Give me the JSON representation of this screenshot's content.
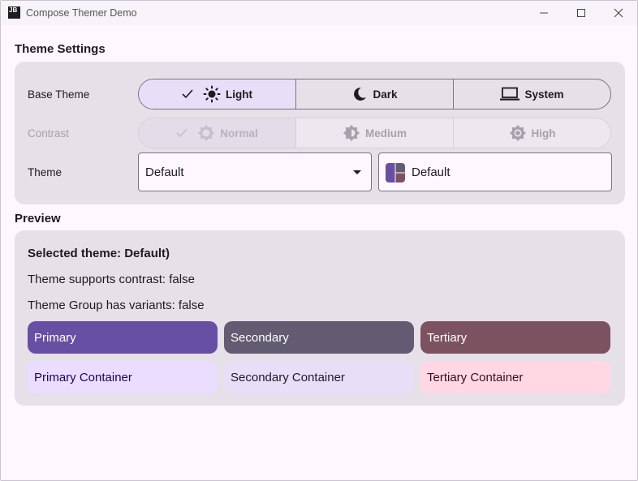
{
  "window": {
    "app_icon_text": "JB",
    "title": "Compose Themer Demo",
    "minimize_icon": "minimize-icon",
    "maximize_icon": "maximize-icon",
    "close_icon": "close-icon"
  },
  "settings": {
    "section_title": "Theme Settings",
    "base_theme": {
      "label": "Base Theme",
      "options": [
        {
          "label": "Light",
          "icon": "sun-icon",
          "selected": true
        },
        {
          "label": "Dark",
          "icon": "moon-icon",
          "selected": false
        },
        {
          "label": "System",
          "icon": "laptop-icon",
          "selected": false
        }
      ]
    },
    "contrast": {
      "label": "Contrast",
      "disabled": true,
      "options": [
        {
          "label": "Normal",
          "icon": "brightness-icon",
          "selected": true
        },
        {
          "label": "Medium",
          "icon": "brightness-half-icon",
          "selected": false
        },
        {
          "label": "High",
          "icon": "brightness-high-icon",
          "selected": false
        }
      ]
    },
    "theme": {
      "label": "Theme",
      "selected_value": "Default",
      "display_label": "Default"
    }
  },
  "preview": {
    "section_title": "Preview",
    "selected_theme_text": "Selected theme: Default)",
    "contrast_support_text": "Theme supports contrast: false",
    "variants_text": "Theme Group has variants: false",
    "colors": [
      {
        "label": "Primary",
        "bg": "#6750a4",
        "fg": "#ffffff"
      },
      {
        "label": "Secondary",
        "bg": "#625b71",
        "fg": "#ffffff"
      },
      {
        "label": "Tertiary",
        "bg": "#7d5260",
        "fg": "#ffffff"
      },
      {
        "label": "Primary Container",
        "bg": "#eaddff",
        "fg": "#21005d"
      },
      {
        "label": "Secondary Container",
        "bg": "#e8def8",
        "fg": "#1d192b"
      },
      {
        "label": "Tertiary Container",
        "bg": "#ffd8e4",
        "fg": "#31111d"
      }
    ]
  }
}
